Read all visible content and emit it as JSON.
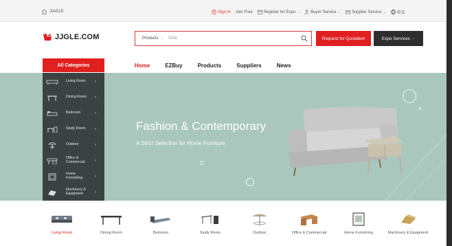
{
  "topbar": {
    "brand": "JIAGLE",
    "sign_in": "Sign In",
    "join_free": "Join Free",
    "register_expo": "Register for Expo",
    "buyer_service": "Buyer Service",
    "supplier_service": "Supplier Service",
    "language": "中文"
  },
  "header": {
    "logo_text": "JJGLE.COM",
    "search_category": "Products",
    "search_placeholder": "Sofa",
    "rfq_button": "Request for Quotation",
    "expo_button": "Expo Services"
  },
  "nav": {
    "all_categories": "All Categories",
    "tabs": [
      "Home",
      "EZBuy",
      "Products",
      "Suppliers",
      "News"
    ]
  },
  "sidebar": {
    "items": [
      {
        "label": "Living Room",
        "icon": "sofa-icon"
      },
      {
        "label": "Dining Room",
        "icon": "dining-table-icon"
      },
      {
        "label": "Bedroom",
        "icon": "bed-icon"
      },
      {
        "label": "Study Room",
        "icon": "desk-icon"
      },
      {
        "label": "Outdoor",
        "icon": "umbrella-icon"
      },
      {
        "label": "Office & Commercial",
        "icon": "office-desk-icon"
      },
      {
        "label": "Home Furnishing",
        "icon": "frame-icon"
      },
      {
        "label": "Machinery & Equipment",
        "icon": "machine-icon"
      }
    ]
  },
  "hero": {
    "headline": "Fashion & Contemporary",
    "subheadline": "A Strict Selection for Home Furniture",
    "background": "#a9c7bd"
  },
  "categories": {
    "items": [
      {
        "label": "Living Room",
        "icon": "sofa-icon"
      },
      {
        "label": "Dining Room",
        "icon": "dining-table-icon"
      },
      {
        "label": "Bedroom",
        "icon": "bed-icon"
      },
      {
        "label": "Study Room",
        "icon": "desk-icon"
      },
      {
        "label": "Outdoor",
        "icon": "umbrella-icon"
      },
      {
        "label": "Office & Commercial",
        "icon": "office-desk-icon"
      },
      {
        "label": "Home Furnishing",
        "icon": "frame-icon"
      },
      {
        "label": "Machinery & Equipment",
        "icon": "machine-icon"
      }
    ]
  },
  "colors": {
    "accent": "#e0201f",
    "dark": "#2e2e2e"
  }
}
